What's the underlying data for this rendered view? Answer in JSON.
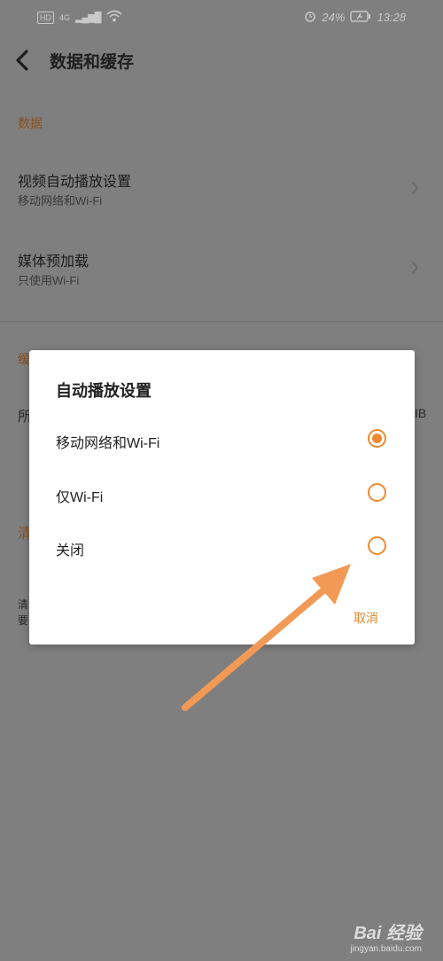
{
  "status_bar": {
    "network_badge": "HD",
    "network_type": "4G",
    "signal": "▂▄▆█",
    "battery_percent": "24%",
    "time": "13:28",
    "icons": [
      "hd-icon",
      "signal-icon",
      "wifi-icon",
      "alarm-icon",
      "battery-icon"
    ]
  },
  "header": {
    "title": "数据和缓存"
  },
  "sections": {
    "data_label": "数据",
    "cache_label_partial": "缓",
    "clear_label_partial": "清"
  },
  "items": [
    {
      "title": "视频自动播放设置",
      "subtitle": "移动网络和Wi-Fi"
    },
    {
      "title": "媒体预加载",
      "subtitle": "只使用Wi-Fi"
    }
  ],
  "bg_fragments": {
    "all_partial": "所",
    "size_suffix": "IB",
    "desc_line1": "清",
    "desc_line2": "要"
  },
  "dialog": {
    "title": "自动播放设置",
    "options": [
      {
        "label": "移动网络和Wi-Fi",
        "selected": true
      },
      {
        "label": "仅Wi-Fi",
        "selected": false
      },
      {
        "label": "关闭",
        "selected": false
      }
    ],
    "cancel_label": "取消",
    "accent_color": "#ef8a2c"
  },
  "watermark": {
    "logo": "Bai 经验",
    "url": "jingyan.baidu.com"
  }
}
